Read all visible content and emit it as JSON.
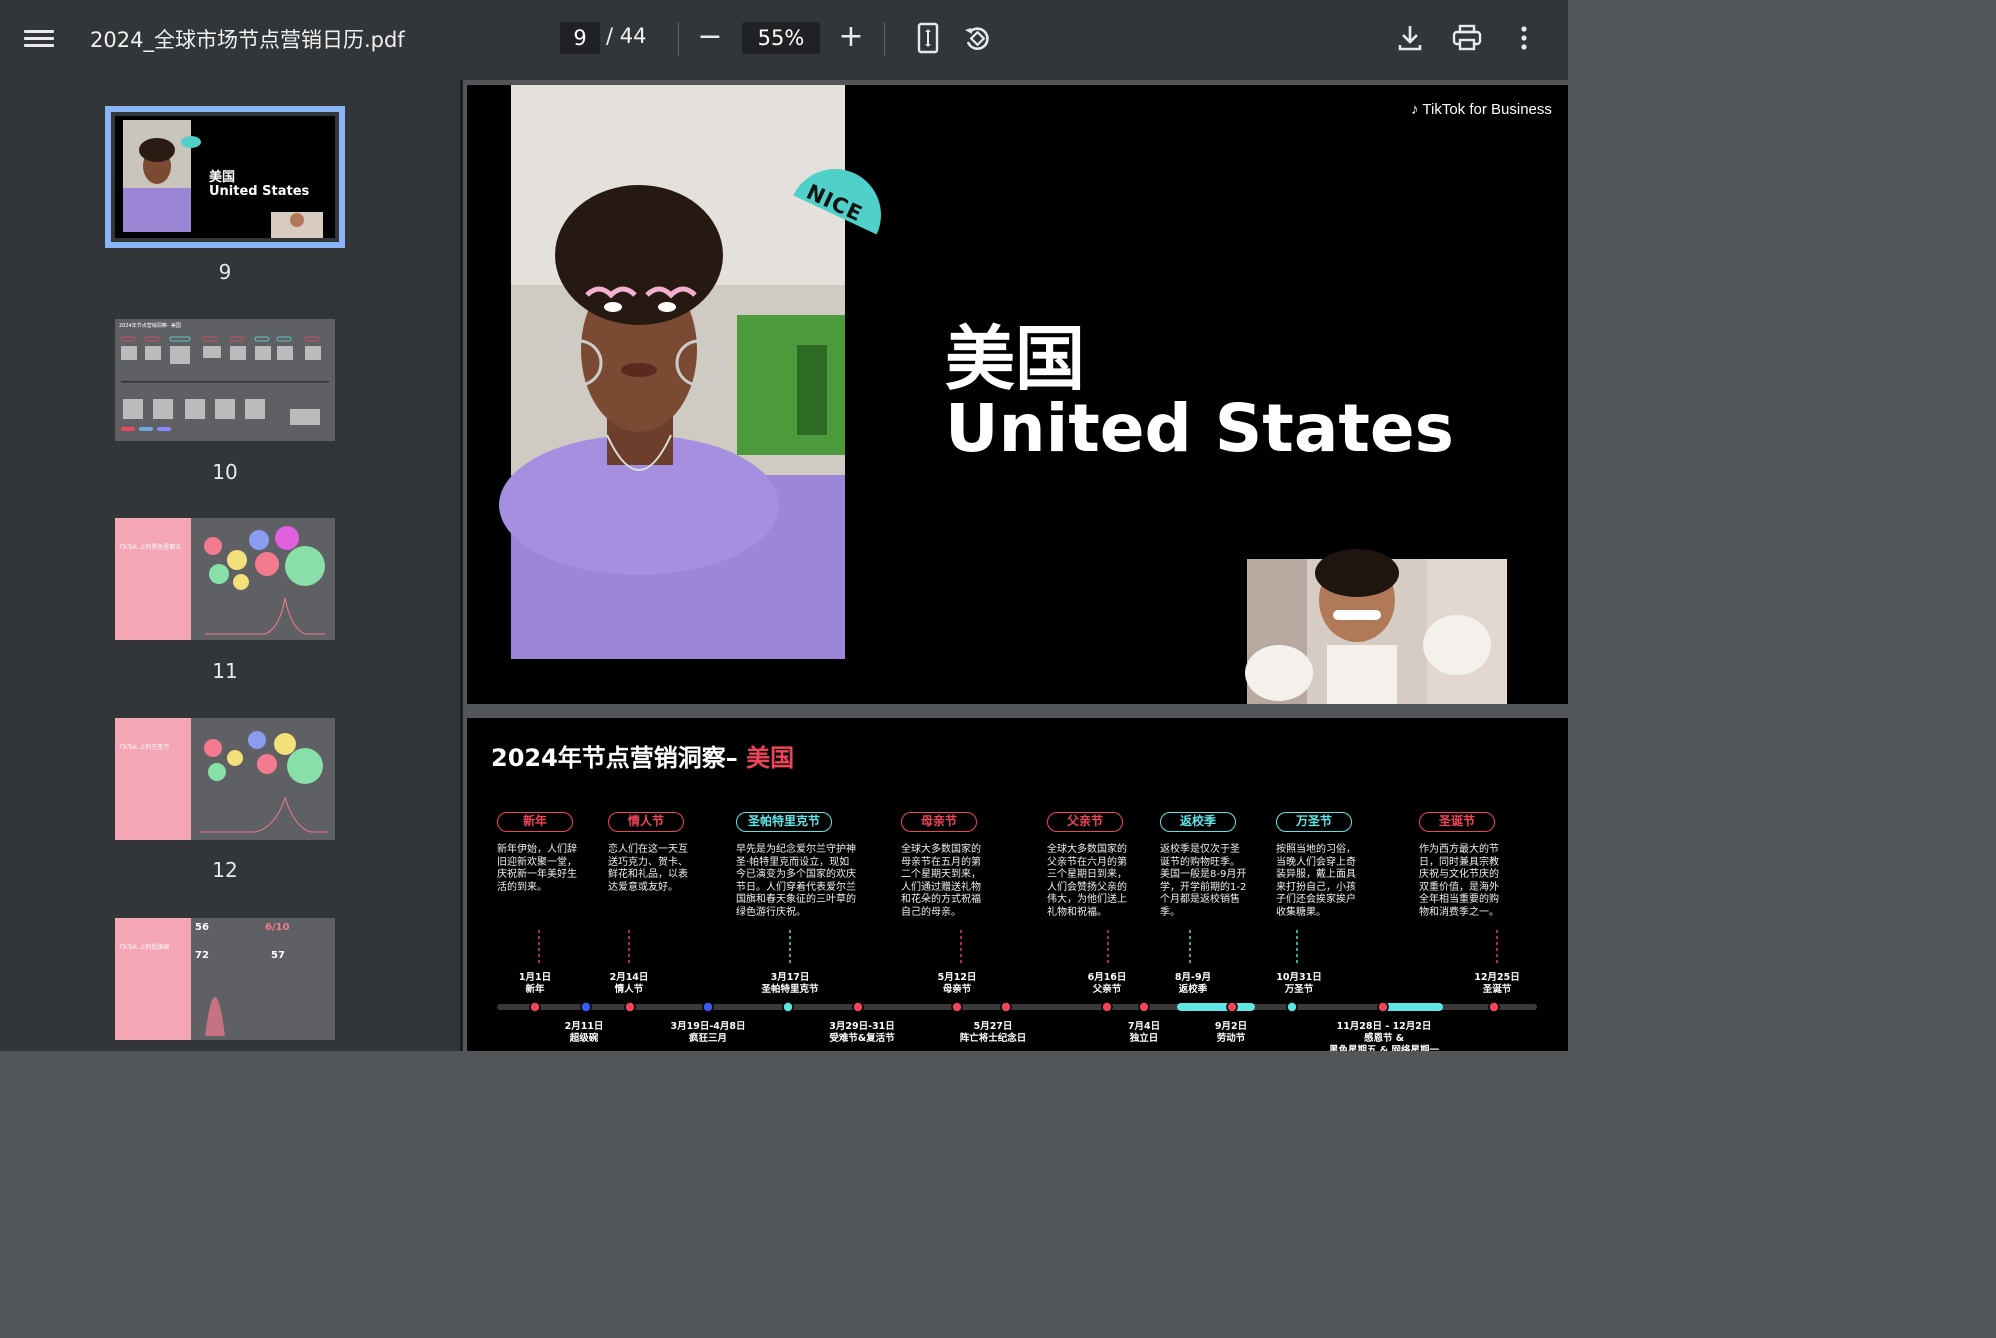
{
  "toolbar": {
    "title": "2024_全球市场节点营销日历.pdf",
    "current_page": "9",
    "page_total": "/ 44",
    "zoom": "55%",
    "zoom_out": "−",
    "zoom_in": "+"
  },
  "thumbnails": [
    {
      "num": "9",
      "selected": true,
      "title_cn": "美国",
      "title_en": "United States"
    },
    {
      "num": "10",
      "title": "2024年节点营销洞察– 美国"
    },
    {
      "num": "11",
      "title": "TikTok 上的黑色星期五"
    },
    {
      "num": "12",
      "title": "TikTok 上的万圣节"
    },
    {
      "num": "",
      "title": "TikTok 上的超级碗",
      "stat1": "56",
      "stat2": "6/10",
      "stat3": "72",
      "stat4": "57"
    }
  ],
  "slide1": {
    "brand": "TikTok for Business",
    "badge": "NICE",
    "title_cn": "美国",
    "title_en": "United States"
  },
  "slide2": {
    "title_prefix": "2024年节点营销洞察– ",
    "title_highlight": "美国",
    "events": [
      {
        "tag": "新年",
        "color": "#f0445b",
        "desc": "新年伊始，人们辞旧迎新欢聚一堂，庆祝新一年美好生活的到来。"
      },
      {
        "tag": "情人节",
        "color": "#f0445b",
        "desc": "恋人们在这一天互送巧克力、贺卡、鲜花和礼品，以表达爱意或友好。"
      },
      {
        "tag": "圣帕特里克节",
        "color": "#5ee6e6",
        "desc": "早先是为纪念爱尔兰守护神圣·帕特里克而设立，现如今已演变为多个国家的欢庆节日。人们穿着代表爱尔兰国旗和春天象征的三叶草的绿色游行庆祝。"
      },
      {
        "tag": "母亲节",
        "color": "#f0445b",
        "desc": "全球大多数国家的母亲节在五月的第二个星期天到来，人们通过赠送礼物和花朵的方式祝福自己的母亲。"
      },
      {
        "tag": "父亲节",
        "color": "#f0445b",
        "desc": "全球大多数国家的父亲节在六月的第三个星期日到来，人们会赞扬父亲的伟大，为他们送上礼物和祝福。"
      },
      {
        "tag": "返校季",
        "color": "#5ee6e6",
        "desc": "返校季是仅次于圣诞节的购物旺季。美国一般是8-9月开学，开学前期的1-2个月都是返校销售季。"
      },
      {
        "tag": "万圣节",
        "color": "#5ee6e6",
        "desc": "按照当地的习俗，当晚人们会穿上奇装异服，戴上面具来打扮自己，小孩子们还会挨家挨户收集糖果。"
      },
      {
        "tag": "圣诞节",
        "color": "#f0445b",
        "desc": "作为西方最大的节日，同时兼具宗教庆祝与文化节庆的双重价值，是海外全年相当重要的购物和消费季之一。"
      }
    ],
    "top_labels": [
      {
        "date": "1月1日",
        "name": "新年"
      },
      {
        "date": "2月14日",
        "name": "情人节"
      },
      {
        "date": "3月17日",
        "name": "圣帕特里克节"
      },
      {
        "date": "5月12日",
        "name": "母亲节"
      },
      {
        "date": "6月16日",
        "name": "父亲节"
      },
      {
        "date": "8月-9月",
        "name": "返校季"
      },
      {
        "date": "10月31日",
        "name": "万圣节"
      },
      {
        "date": "12月25日",
        "name": "圣诞节"
      }
    ],
    "bottom_labels": [
      {
        "date": "2月11日",
        "name": "超级碗"
      },
      {
        "date": "3月19日-4月8日",
        "name": "疯狂三月"
      },
      {
        "date": "3月29日-31日",
        "name": "受难节&复活节"
      },
      {
        "date": "5月27日",
        "name": "阵亡将士纪念日"
      },
      {
        "date": "7月4日",
        "name": "独立日"
      },
      {
        "date": "9月2日",
        "name": "劳动节"
      },
      {
        "date": "11月28日 - 12月2日",
        "name": "感恩节 &"
      },
      {
        "date": "",
        "name": "黑色星期五 & 网络星期一"
      }
    ]
  }
}
